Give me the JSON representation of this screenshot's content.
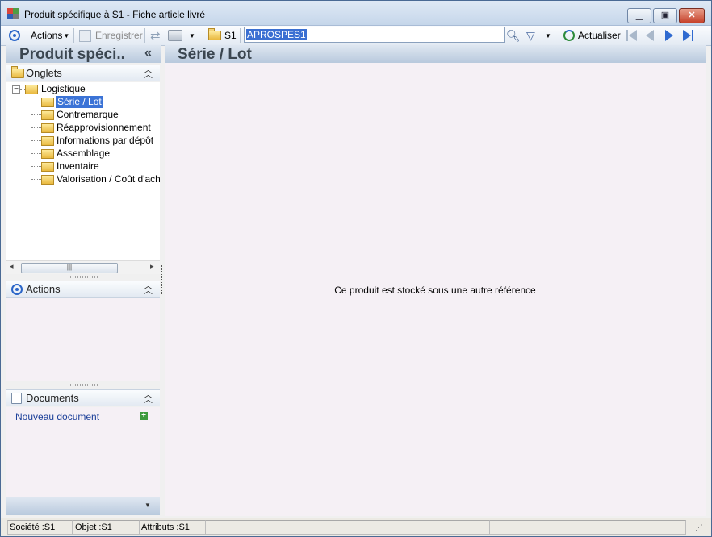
{
  "window": {
    "title": "Produit spécifique à S1 -  Fiche article livré"
  },
  "toolbar": {
    "actions_label": "Actions",
    "save_label": "Enregistrer",
    "s1_label": "S1",
    "search_value": "APROSPES1",
    "refresh_label": "Actualiser"
  },
  "sidebar": {
    "title": "Produit spéci..",
    "collapse_glyph": "«",
    "tabs_header": "Onglets",
    "tree": {
      "root": "Logistique",
      "items": [
        "Série / Lot",
        "Contremarque",
        "Réapprovisionnement",
        "Informations par dépôt",
        "Assemblage",
        "Inventaire",
        "Valorisation / Coût d'achat"
      ]
    },
    "actions_header": "Actions",
    "documents_header": "Documents",
    "new_document_link": "Nouveau document"
  },
  "main": {
    "title": "Série / Lot",
    "message": "Ce produit est stocké sous une autre référence"
  },
  "status": {
    "company": "Société :S1",
    "object": "Objet :S1",
    "attributes": "Attributs :S1"
  },
  "colors": {
    "selection": "#3b73d6",
    "panel_header": "#b8c9dd",
    "content_bg": "#f5f0f5"
  }
}
